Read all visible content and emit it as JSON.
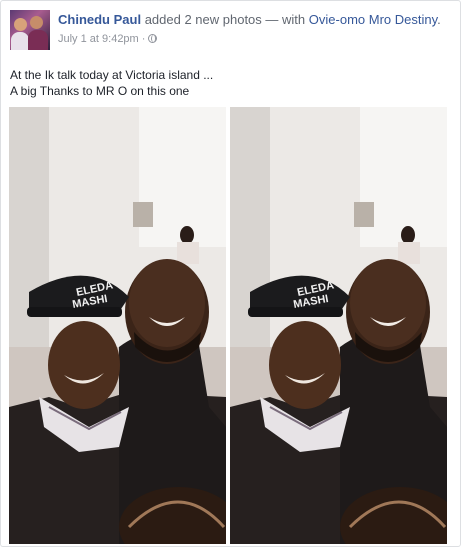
{
  "post": {
    "author": "Chinedu Paul",
    "action": "added 2 new photos",
    "with_prefix": "— with",
    "tagged": "Ovie-omo Mro Destiny",
    "trailing": ".",
    "timestamp": "July 1 at 9:42pm",
    "separator": "·",
    "privacy_icon": "globe-icon",
    "lines": [
      "At the Ik talk today at Victoria island ...",
      "A big Thanks to MR O on this one"
    ]
  },
  "photos": [
    {
      "alt": "selfie photo 1",
      "cap_text": "ELEDA MASHI"
    },
    {
      "alt": "selfie photo 2",
      "cap_text": "ELEDA MASHI"
    }
  ]
}
